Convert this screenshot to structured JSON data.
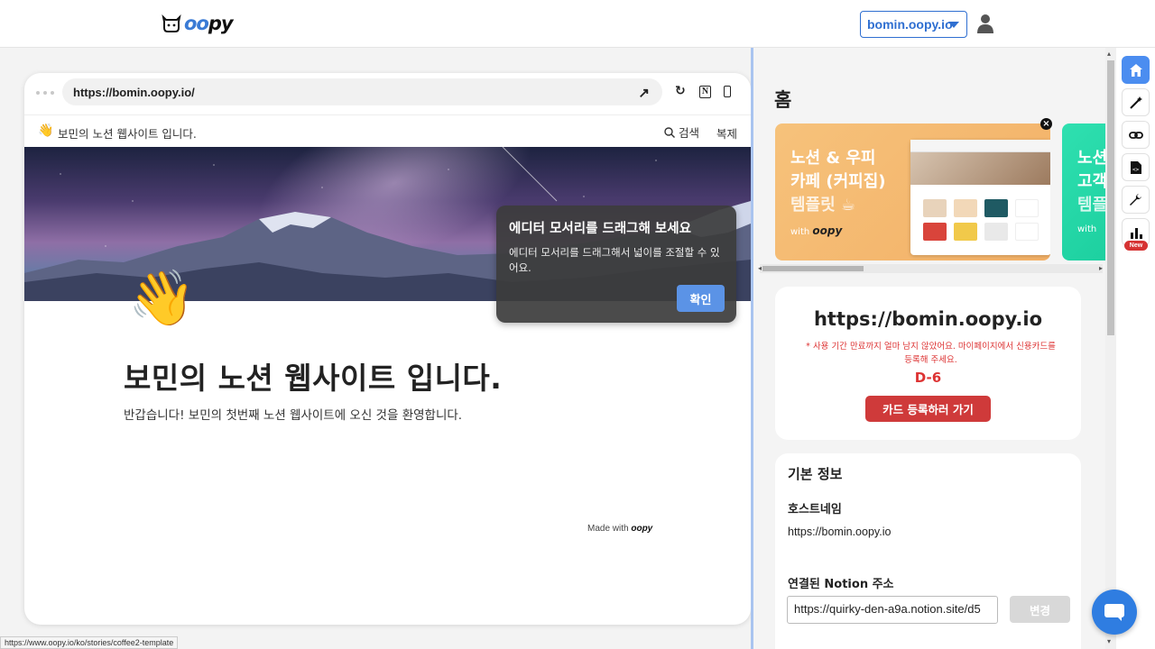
{
  "header": {
    "logo_text_prefix": "",
    "logo_text_oo": "oo",
    "logo_text_suffix": "py",
    "domain_select": "bomin.oopy.io"
  },
  "preview": {
    "url": "https://bomin.oopy.io/",
    "nav_title": "보민의 노션 웹사이트 입니다.",
    "nav_emoji": "👋",
    "search_label": "검색",
    "duplicate_label": "복제",
    "page_emoji": "👋",
    "page_title": "보민의 노션 웹사이트 입니다.",
    "page_description": "반갑습니다! 보민의 첫번째 노션 웹사이트에 오신 것을 환영합니다.",
    "made_with_prefix": "Made with ",
    "made_with_brand": "oopy"
  },
  "tooltip": {
    "title": "에디터 모서리를 드래그해 보세요",
    "body": "에디터 모서리를 드래그해서 넓이를 조절할 수 있어요.",
    "confirm_label": "확인"
  },
  "panel": {
    "title": "홈",
    "banners": [
      {
        "line1": "노션 & 우피",
        "line2": "카페 (커피집)",
        "line3": "템플릿 ☕",
        "with": "with ",
        "brand": "oopy"
      },
      {
        "line1": "노션",
        "line2": "고객",
        "line3": "템플",
        "with": "with ",
        "brand": "oopy"
      }
    ],
    "site_card": {
      "domain": "https://bomin.oopy.io",
      "warning": "* 사용 기간 만료까지 얼마 남지 않았어요. 마이페이지에서 신용카드를 등록해 주세요.",
      "dday": "D-6",
      "register_button": "카드 등록하러 가기"
    },
    "info_card": {
      "title": "기본 정보",
      "host_label": "호스트네임",
      "host_value": "https://bomin.oopy.io",
      "notion_label": "연결된 Notion 주소",
      "notion_value": "https://quirky-den-a9a.notion.site/d5",
      "change_button": "변경"
    }
  },
  "rail": {
    "items": [
      "home-icon",
      "magic-wand-icon",
      "link-icon",
      "code-file-icon",
      "wrench-icon",
      "chart-icon"
    ],
    "new_badge": "New"
  },
  "status_bar": {
    "url": "https://www.oopy.io/ko/stories/coffee2-template"
  },
  "colors": {
    "accent": "#4b8df0",
    "brand_blue": "#2f6fd1",
    "danger": "#cf3a3a",
    "tooltip_bg": "#3c3c3c"
  }
}
